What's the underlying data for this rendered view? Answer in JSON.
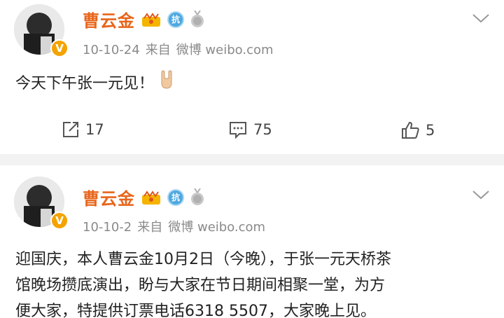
{
  "post1": {
    "author": "曹云金",
    "date": "10-10-24",
    "source_prefix": "来自",
    "source": "微博 weibo.com",
    "text": "今天下午张一元见！",
    "actions": {
      "forward_count": "17",
      "comment_count": "75",
      "like_count": "5"
    }
  },
  "post2": {
    "author": "曹云金",
    "date": "10-10-2",
    "source_prefix": "来自",
    "source": "微博 weibo.com",
    "text_line1": "迎国庆，本人曹云金10月2日（今晚），于张一元天桥茶",
    "text_line2": "馆晚场攒底演出，盼与大家在节日期间相聚一堂，为方",
    "text_line3": "便大家，特提供订票电话6318 5507，大家晚上见。"
  },
  "badges": {
    "verified": "V",
    "kang": "抗"
  },
  "colors": {
    "author_name": "#e8651a",
    "verified_badge": "#f4a300",
    "kang_badge": "#4da8e0",
    "meta_text": "#8a8a8a"
  },
  "icons": {
    "forward": "forward-icon",
    "comment": "comment-icon",
    "like": "thumbs-up-icon",
    "menu": "chevron-down-icon",
    "crown": "crown-icon",
    "medal": "medal-icon",
    "hand": "rock-hand-emoji-icon"
  }
}
